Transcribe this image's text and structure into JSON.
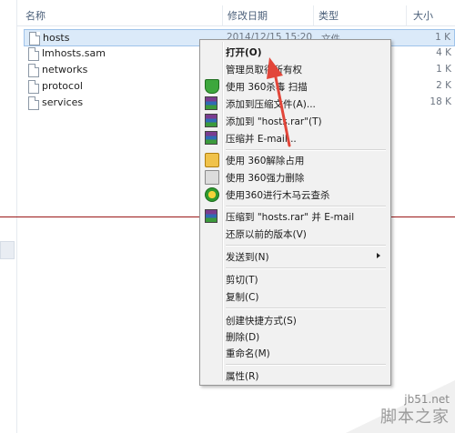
{
  "columns": {
    "name": "名称",
    "date": "修改日期",
    "type": "类型",
    "size": "大小"
  },
  "files": [
    {
      "name": "hosts",
      "date": "2014/12/15 15:20",
      "type": "文件",
      "size": "1 K",
      "selected": true
    },
    {
      "name": "lmhosts.sam",
      "date": "",
      "type": "",
      "size": "4 K"
    },
    {
      "name": "networks",
      "date": "",
      "type": "",
      "size": "1 K"
    },
    {
      "name": "protocol",
      "date": "",
      "type": "",
      "size": "2 K"
    },
    {
      "name": "services",
      "date": "",
      "type": "",
      "size": "18 K"
    }
  ],
  "menu": {
    "open": "打开(O)",
    "admin_owner": "管理员取得所有权",
    "scan360": "使用 360杀毒 扫描",
    "add_archive": "添加到压缩文件(A)...",
    "add_hosts_rar": "添加到 \"hosts.rar\"(T)",
    "compress_email": "压缩并 E-mail...",
    "unlock360": "使用 360解除占用",
    "force_delete360": "使用 360强力删除",
    "trojan360": "使用360进行木马云查杀",
    "compress_rar_email": "压缩到 \"hosts.rar\" 并 E-mail",
    "restore": "还原以前的版本(V)",
    "send_to": "发送到(N)",
    "cut": "剪切(T)",
    "copy": "复制(C)",
    "shortcut": "创建快捷方式(S)",
    "delete": "删除(D)",
    "rename": "重命名(M)",
    "properties": "属性(R)"
  },
  "icons": {
    "scan": "shield-icon",
    "rar": "winrar-icon",
    "unlock": "lock-icon",
    "force_delete": "shredder-icon",
    "trojan": "horse-icon"
  },
  "watermark": {
    "url": "jb51.net",
    "site": "脚本之家"
  },
  "colors": {
    "annotation_red": "#e2463a",
    "selection": "#dbeaf9"
  }
}
